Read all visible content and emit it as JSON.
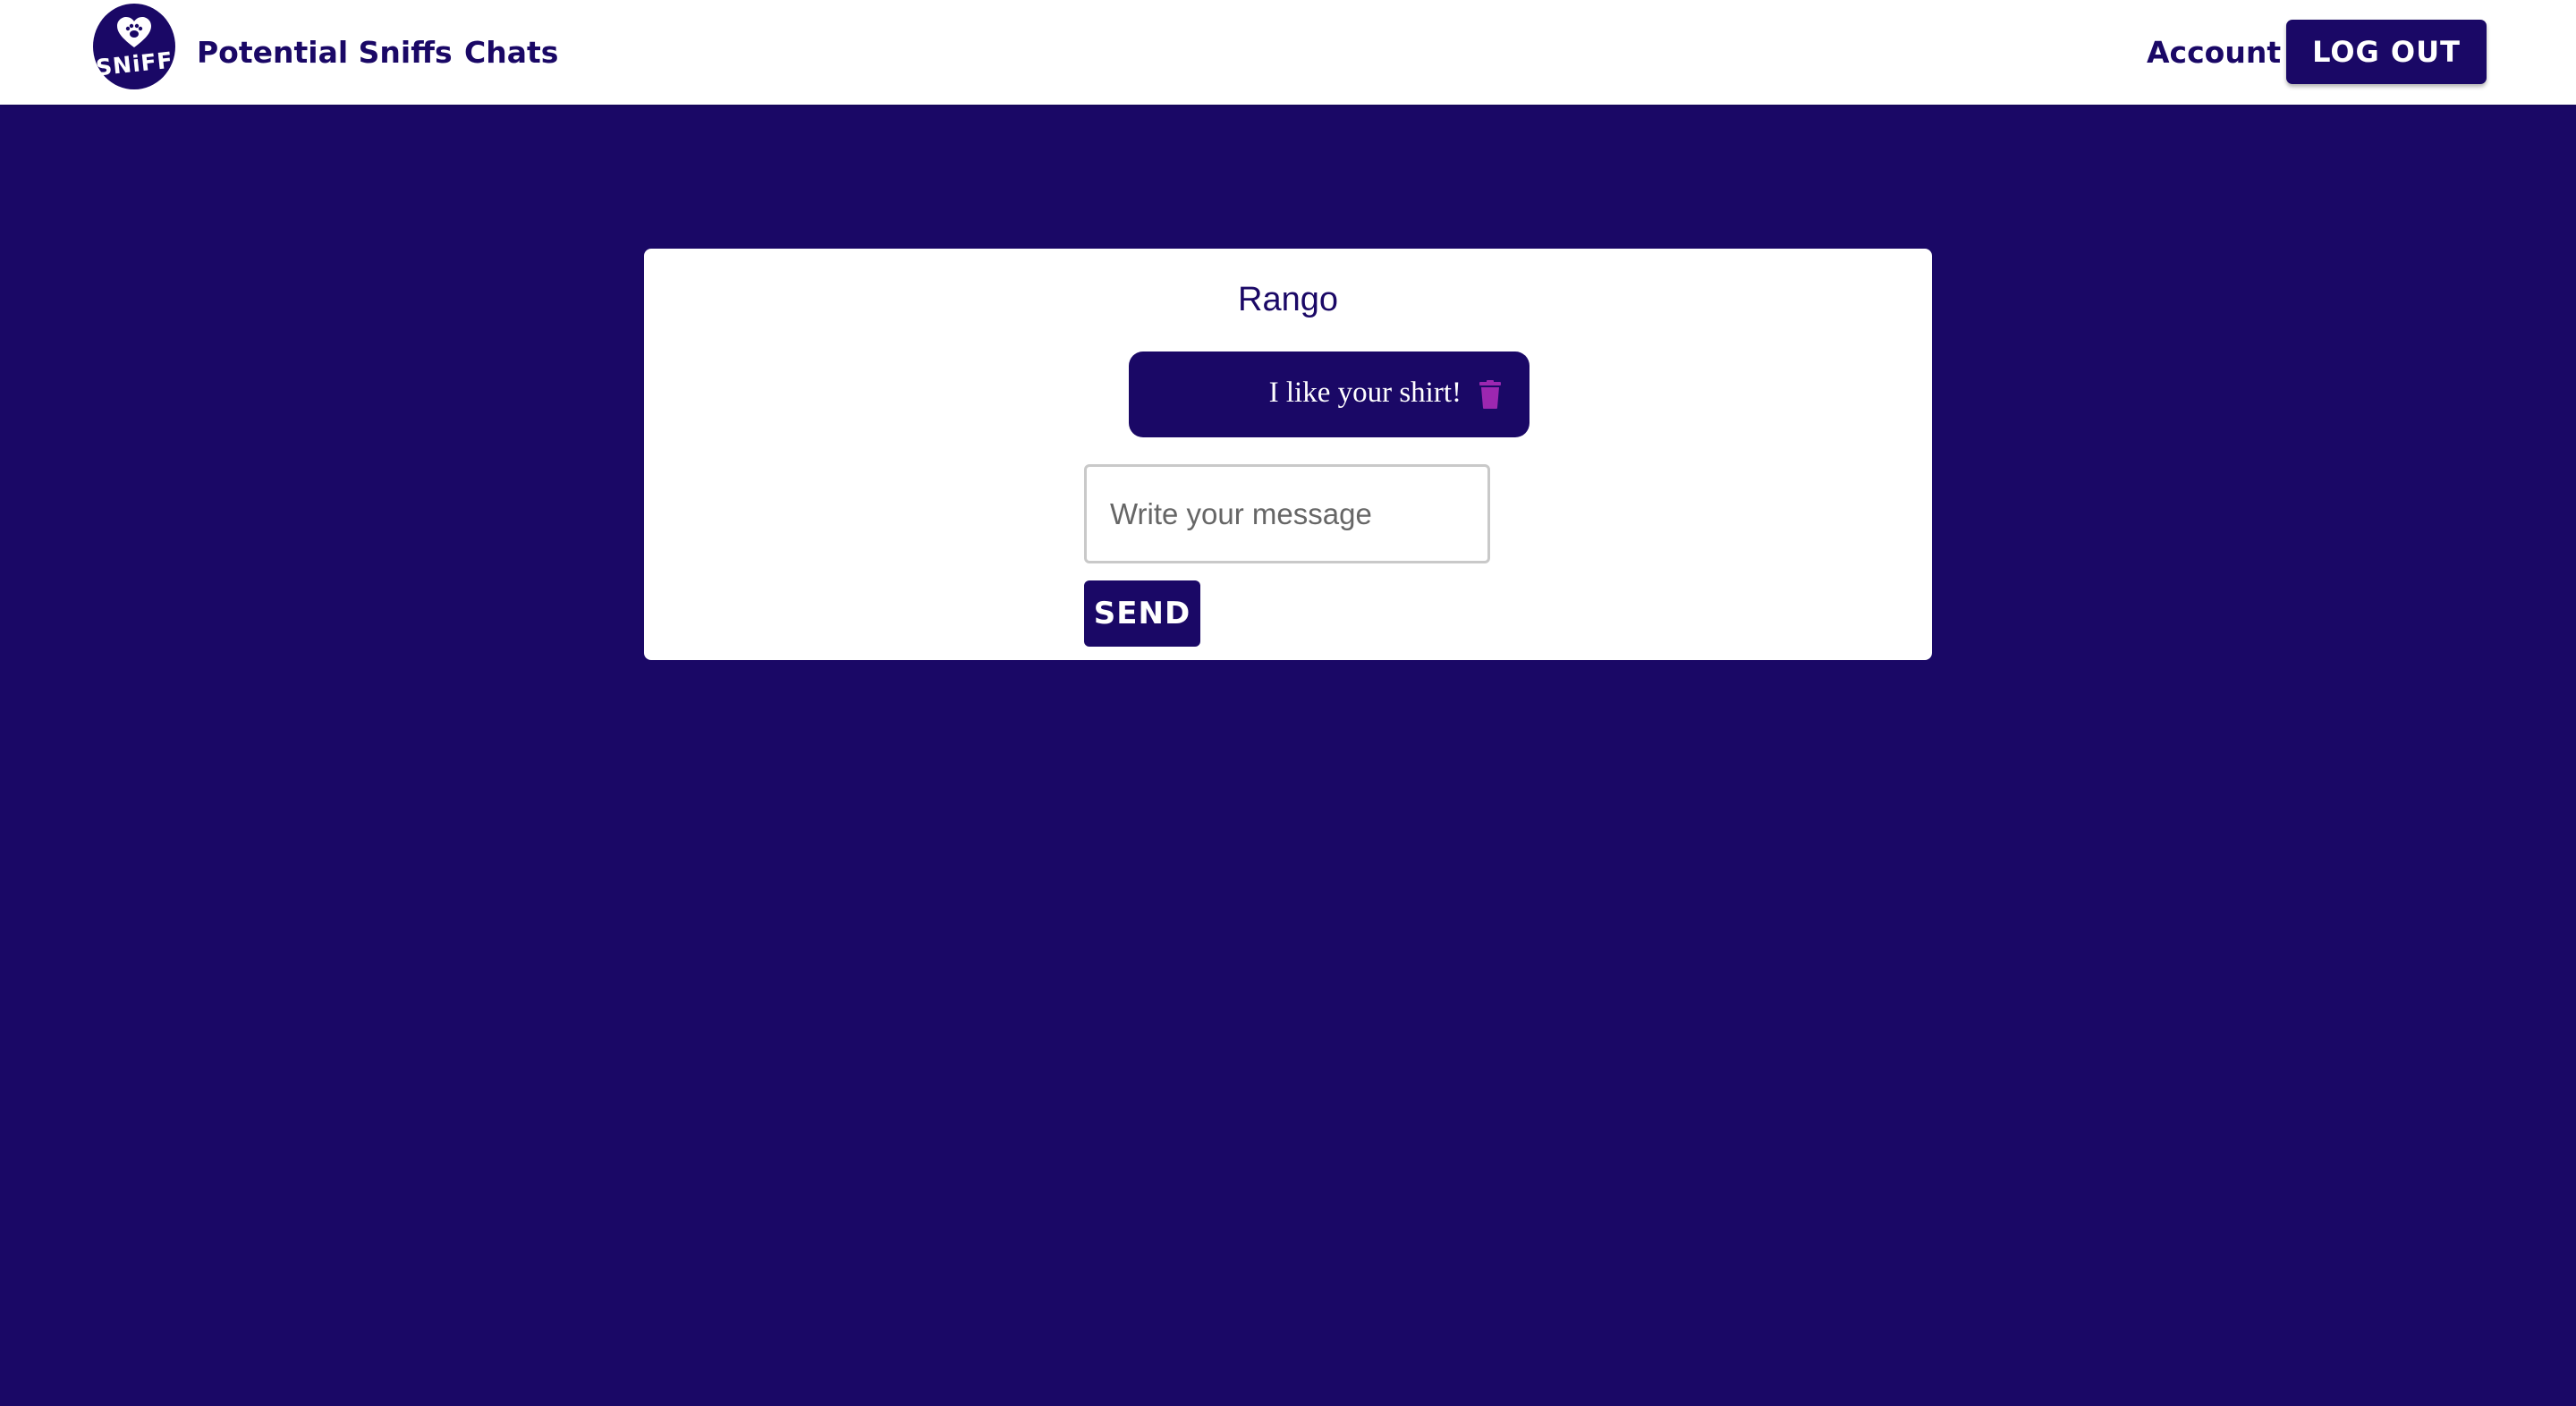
{
  "brand": {
    "logo_text": "SNiFF",
    "logo_icon": "heart-paw-icon"
  },
  "nav": {
    "potential_sniffs": "Potential Sniffs",
    "chats": "Chats",
    "account": "Account",
    "logout": "LOG OUT"
  },
  "chat": {
    "partner_name": "Rango",
    "messages": [
      {
        "text": "I like your shirt!",
        "action_icon": "trash-icon"
      }
    ],
    "input_placeholder": "Write your message",
    "input_value": "",
    "send_label": "SEND"
  },
  "colors": {
    "primary": "#1a0866",
    "surface": "#ffffff",
    "delete_icon": "#9c27b0",
    "input_border": "#c9c9c9"
  }
}
